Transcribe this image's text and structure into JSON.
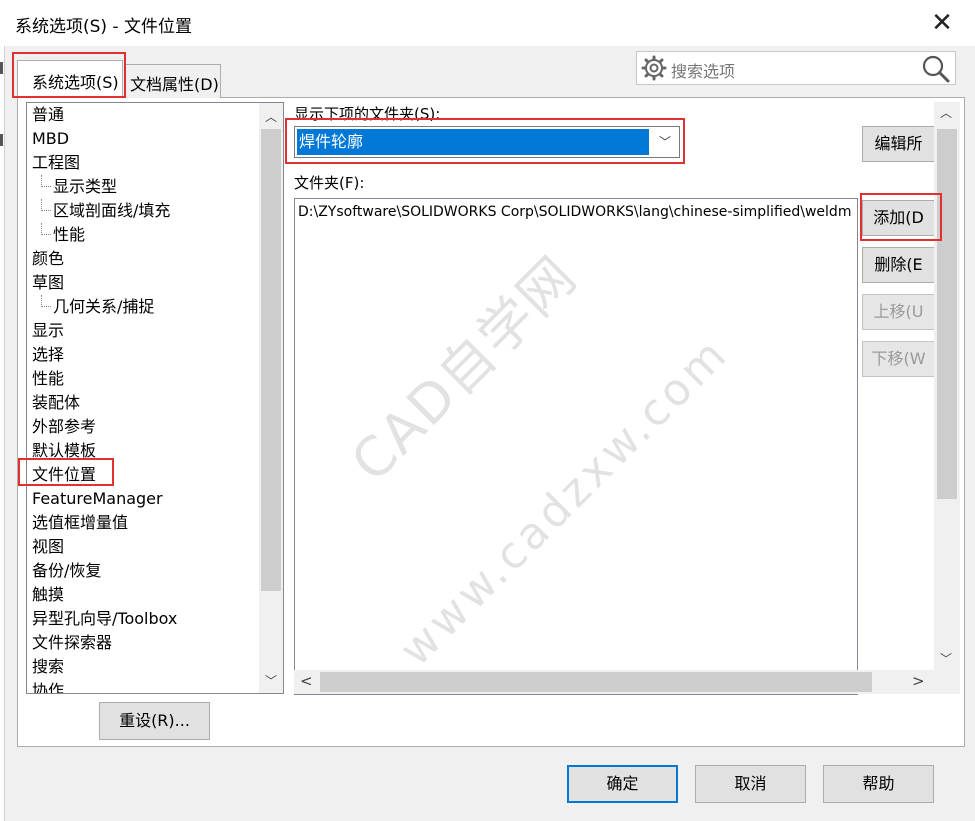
{
  "window": {
    "title": "系统选项(S) - 文件位置",
    "close_glyph": "✕"
  },
  "tabs": [
    {
      "label": "系统选项(S)",
      "active": true
    },
    {
      "label": "文档属性(D)",
      "active": false
    }
  ],
  "search": {
    "placeholder": "搜索选项"
  },
  "tree": {
    "items": [
      {
        "label": "普通",
        "level": 0
      },
      {
        "label": "MBD",
        "level": 0
      },
      {
        "label": "工程图",
        "level": 0
      },
      {
        "label": "显示类型",
        "level": 1
      },
      {
        "label": "区域剖面线/填充",
        "level": 1
      },
      {
        "label": "性能",
        "level": 1
      },
      {
        "label": "颜色",
        "level": 0
      },
      {
        "label": "草图",
        "level": 0
      },
      {
        "label": "几何关系/捕捉",
        "level": 1
      },
      {
        "label": "显示",
        "level": 0
      },
      {
        "label": "选择",
        "level": 0
      },
      {
        "label": "性能",
        "level": 0
      },
      {
        "label": "装配体",
        "level": 0
      },
      {
        "label": "外部参考",
        "level": 0
      },
      {
        "label": "默认模板",
        "level": 0
      },
      {
        "label": "文件位置",
        "level": 0,
        "selected": true
      },
      {
        "label": "FeatureManager",
        "level": 0
      },
      {
        "label": "选值框增量值",
        "level": 0
      },
      {
        "label": "视图",
        "level": 0
      },
      {
        "label": "备份/恢复",
        "level": 0
      },
      {
        "label": "触摸",
        "level": 0
      },
      {
        "label": "异型孔向导/Toolbox",
        "level": 0
      },
      {
        "label": "文件探索器",
        "level": 0
      },
      {
        "label": "搜索",
        "level": 0
      },
      {
        "label": "协作",
        "level": 0
      }
    ]
  },
  "reset_button": "重设(R)...",
  "show_folders_label": "显示下项的文件夹(S):",
  "show_folders_value": "焊件轮廓",
  "folders_label": "文件夹(F):",
  "folder_paths": [
    "D:\\ZYsoftware\\SOLIDWORKS Corp\\SOLIDWORKS\\lang\\chinese-simplified\\weldm"
  ],
  "side_buttons": {
    "edit": "编辑所",
    "add": "添加(D",
    "delete": "删除(E",
    "move_up": "上移(U",
    "move_down": "下移(W"
  },
  "footer": {
    "ok": "确定",
    "cancel": "取消",
    "help": "帮助"
  },
  "watermark": {
    "line1": "CAD自学网",
    "line2": "www.cadzxw.com"
  },
  "colors": {
    "selection": "#0078d7",
    "highlight_box": "#e03030",
    "primary_border": "#0078d7"
  }
}
